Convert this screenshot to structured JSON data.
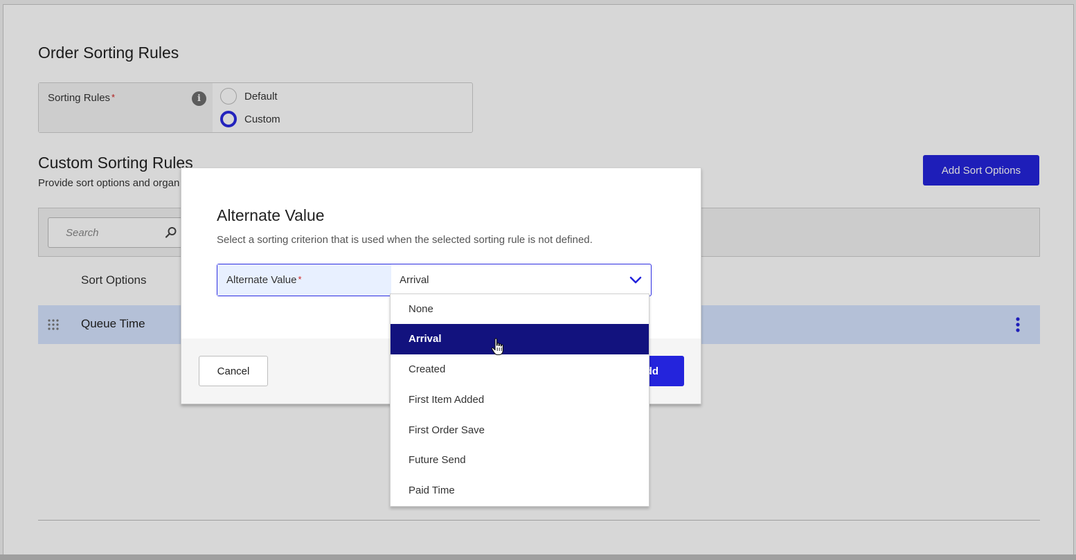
{
  "page": {
    "title": "Order Sorting Rules",
    "sorting_rules": {
      "label": "Sorting Rules",
      "required_mark": "*",
      "options": [
        {
          "label": "Default",
          "selected": false
        },
        {
          "label": "Custom",
          "selected": true
        }
      ]
    },
    "custom_section": {
      "title": "Custom Sorting Rules",
      "subtitle": "Provide sort options and organ",
      "add_button": "Add Sort Options"
    },
    "search": {
      "placeholder": "Search"
    },
    "table": {
      "column_header": "Sort Options",
      "rows": [
        {
          "label": "Queue Time"
        }
      ]
    }
  },
  "modal": {
    "title": "Alternate Value",
    "description": "Select a sorting criterion that is used when the selected sorting rule is not defined.",
    "field": {
      "label": "Alternate Value",
      "required_mark": "*",
      "value": "Arrival"
    },
    "cancel_label": "Cancel",
    "add_label": "dd"
  },
  "dropdown": {
    "options": [
      "None",
      "Arrival",
      "Created",
      "First Item Added",
      "First Order Save",
      "Future Send",
      "Paid Time"
    ],
    "selected": "Arrival"
  },
  "colors": {
    "primary": "#2424dc",
    "selected_option": "#12127e",
    "row_highlight": "#d6e4ff"
  }
}
